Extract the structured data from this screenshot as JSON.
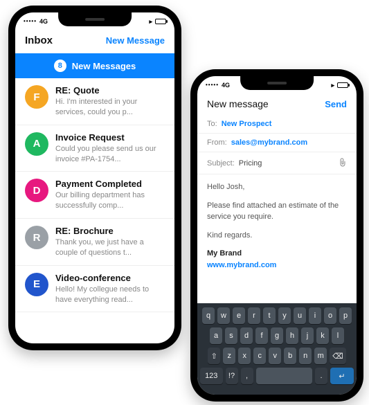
{
  "phone_a": {
    "status": {
      "signal_label": "4G"
    },
    "header": {
      "title": "Inbox",
      "action": "New Message"
    },
    "banner": {
      "count": "8",
      "label": "New Messages"
    },
    "messages": [
      {
        "letter": "F",
        "color": "#f5a623",
        "subject": "RE: Quote",
        "preview": "Hi. I'm interested in your services, could you p..."
      },
      {
        "letter": "A",
        "color": "#1fb860",
        "subject": "Invoice Request",
        "preview": "Could you please send us our invoice #PA-1754..."
      },
      {
        "letter": "D",
        "color": "#e7187f",
        "subject": "Payment Completed",
        "preview": "Our billing department has successfully comp..."
      },
      {
        "letter": "R",
        "color": "#9aa0a6",
        "subject": "RE: Brochure",
        "preview": "Thank you, we just have a couple of questions t..."
      },
      {
        "letter": "E",
        "color": "#2155cc",
        "subject": "Video-conference",
        "preview": "Hello! My collegue needs to have everything read..."
      }
    ]
  },
  "phone_b": {
    "status": {
      "signal_label": "4G"
    },
    "header": {
      "title": "New message",
      "action": "Send"
    },
    "fields": {
      "to_label": "To:",
      "to_value": "New Prospect",
      "from_label": "From:",
      "from_value": "sales@mybrand.com",
      "subject_label": "Subject:",
      "subject_value": "Pricing"
    },
    "body": {
      "greeting": "Hello Josh,",
      "main": "Please find attached an estimate of the service you require.",
      "closing": "Kind regards.",
      "brand": "My Brand",
      "url": "www.mybrand.com"
    },
    "keyboard": {
      "row1": [
        "q",
        "w",
        "e",
        "r",
        "t",
        "y",
        "u",
        "i",
        "o",
        "p"
      ],
      "row2": [
        "a",
        "s",
        "d",
        "f",
        "g",
        "h",
        "j",
        "k",
        "l"
      ],
      "row3_shift": "⇧",
      "row3": [
        "z",
        "x",
        "c",
        "v",
        "b",
        "n",
        "m"
      ],
      "row3_bksp": "⌫",
      "row4_num": "123",
      "row4_sym": "!?",
      "row4_comma": ",",
      "row4_period": ".",
      "row4_enter": "↵"
    }
  }
}
